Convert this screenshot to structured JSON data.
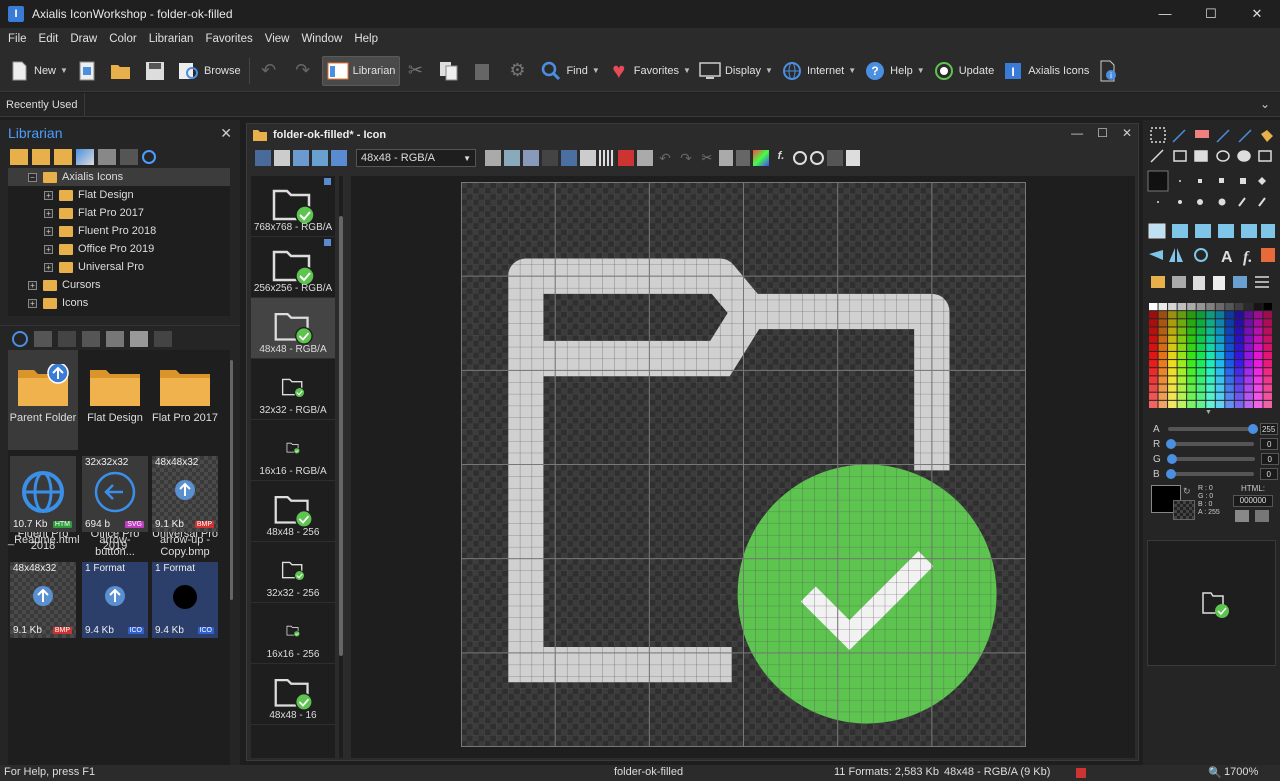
{
  "window": {
    "title": "Axialis IconWorkshop - folder-ok-filled",
    "logo": "I"
  },
  "menu": [
    "File",
    "Edit",
    "Draw",
    "Color",
    "Librarian",
    "Favorites",
    "View",
    "Window",
    "Help"
  ],
  "toolbar": {
    "new": "New",
    "browse": "Browse",
    "librarian": "Librarian",
    "find": "Find",
    "favorites": "Favorites",
    "display": "Display",
    "internet": "Internet",
    "help": "Help",
    "update": "Update",
    "axialis_icons": "Axialis Icons"
  },
  "recent": {
    "label": "Recently Used"
  },
  "librarian": {
    "title": "Librarian",
    "tree": [
      {
        "label": "Axialis Icons",
        "expander": "−",
        "level": 0,
        "selected": true
      },
      {
        "label": "Flat Design",
        "expander": "+",
        "level": 1
      },
      {
        "label": "Flat Pro 2017",
        "expander": "+",
        "level": 1
      },
      {
        "label": "Fluent Pro 2018",
        "expander": "+",
        "level": 1
      },
      {
        "label": "Office Pro 2019",
        "expander": "+",
        "level": 1
      },
      {
        "label": "Universal Pro",
        "expander": "+",
        "level": 1
      },
      {
        "label": "Cursors",
        "expander": "+",
        "level": 0
      },
      {
        "label": "Icons",
        "expander": "+",
        "level": 0
      }
    ],
    "tiles": [
      {
        "label": "Parent Folder"
      },
      {
        "label": "Flat Design"
      },
      {
        "label": "Flat Pro 2017"
      },
      {
        "label": "Fluent Pro 2018"
      },
      {
        "label": "Office Pro 2019"
      },
      {
        "label": "Universal Pro"
      }
    ],
    "files": [
      {
        "header": "",
        "size": "10.7 Kb",
        "badge": "HTM",
        "badge_color": "#2e9c3a",
        "name": "_Readme.html"
      },
      {
        "header": "32x32x32",
        "size": "694 b",
        "badge": "SVG",
        "badge_color": "#c03cc0",
        "name": "arrow-button..."
      },
      {
        "header": "48x48x32",
        "size": "9.1 Kb",
        "badge": "BMP",
        "badge_color": "#d03030",
        "name": "arrow-up - Copy.bmp"
      },
      {
        "header": "48x48x32",
        "size": "9.1 Kb",
        "badge": "BMP",
        "badge_color": "#d03030",
        "name": ""
      },
      {
        "header": "1 Format",
        "size": "9.4 Kb",
        "badge": "ICO",
        "badge_color": "#3060d0",
        "name": ""
      },
      {
        "header": "1 Format",
        "size": "9.4 Kb",
        "badge": "ICO",
        "badge_color": "#3060d0",
        "name": ""
      }
    ]
  },
  "editor": {
    "title": "folder-ok-filled* - Icon",
    "format_select": "48x48 - RGB/A",
    "formats": [
      {
        "label": "768x768 - RGB/A"
      },
      {
        "label": "256x256 - RGB/A"
      },
      {
        "label": "48x48 - RGB/A",
        "selected": true
      },
      {
        "label": "32x32 - RGB/A"
      },
      {
        "label": "16x16 - RGB/A"
      },
      {
        "label": "48x48 - 256"
      },
      {
        "label": "32x32 - 256"
      },
      {
        "label": "16x16 - 256"
      },
      {
        "label": "48x48 - 16"
      }
    ]
  },
  "colors": {
    "folder_stroke": "#d0d0d0",
    "check_green": "#5cc44f",
    "accent": "#4a9eff"
  },
  "right": {
    "sliders": [
      {
        "label": "A",
        "value": "255",
        "level": 1.0
      },
      {
        "label": "R",
        "value": "0",
        "level": 0
      },
      {
        "label": "G",
        "value": "0",
        "level": 0
      },
      {
        "label": "B",
        "value": "0",
        "level": 0
      }
    ],
    "rgba": "R : 0\nG : 0\nB : 0\nA : 255",
    "html_label": "HTML:",
    "html_value": "000000"
  },
  "status": {
    "help": "For Help, press F1",
    "file": "folder-ok-filled",
    "formats": "11 Formats: 2,583 Kb",
    "current": "48x48 - RGB/A (9 Kb)",
    "zoom": "1700%"
  }
}
